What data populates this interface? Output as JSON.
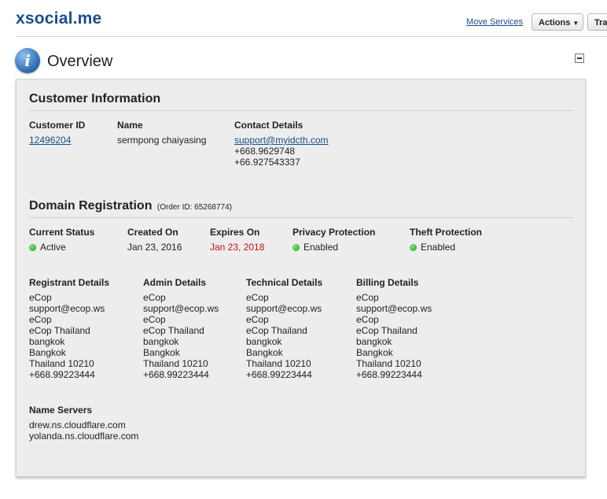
{
  "header": {
    "domain": "xsocial.me",
    "move_services": "Move Services",
    "actions_label": "Actions",
    "transfer_label": "Tra"
  },
  "overview": {
    "title": "Overview",
    "icon": "info-icon"
  },
  "customer": {
    "section_title": "Customer Information",
    "id_label": "Customer ID",
    "id_value": "12496204",
    "name_label": "Name",
    "name_value": "sermpong chaiyasing",
    "contact_label": "Contact Details",
    "email": "support@myidcth.com",
    "phone1": "+668.9629748",
    "phone2": "+66.927543337"
  },
  "domain_reg": {
    "section_title": "Domain Registration",
    "order_id": "(Order ID: 65268774)",
    "status_label": "Current Status",
    "status_value": "Active",
    "created_label": "Created On",
    "created_value": "Jan 23, 2016",
    "expires_label": "Expires On",
    "expires_value": "Jan 23, 2018",
    "privacy_label": "Privacy Protection",
    "privacy_value": "Enabled",
    "theft_label": "Theft Protection",
    "theft_value": "Enabled",
    "status_color": "#1f9a1f",
    "expires_color": "#cc1111"
  },
  "contacts": [
    {
      "label": "Registrant Details",
      "lines": [
        "eCop",
        "support@ecop.ws",
        "eCop",
        "eCop Thailand",
        "bangkok",
        "Bangkok",
        "Thailand 10210",
        "+668.99223444"
      ]
    },
    {
      "label": "Admin Details",
      "lines": [
        "eCop",
        "support@ecop.ws",
        "eCop",
        "eCop Thailand",
        "bangkok",
        "Bangkok",
        "Thailand 10210",
        "+668.99223444"
      ]
    },
    {
      "label": "Technical Details",
      "lines": [
        "eCop",
        "support@ecop.ws",
        "eCop",
        "eCop Thailand",
        "bangkok",
        "Bangkok",
        "Thailand 10210",
        "+668.99223444"
      ]
    },
    {
      "label": "Billing Details",
      "lines": [
        "eCop",
        "support@ecop.ws",
        "eCop",
        "eCop Thailand",
        "bangkok",
        "Bangkok",
        "Thailand 10210",
        "+668.99223444"
      ]
    }
  ],
  "name_servers": {
    "label": "Name Servers",
    "servers": [
      "drew.ns.cloudflare.com",
      "yolanda.ns.cloudflare.com"
    ]
  }
}
